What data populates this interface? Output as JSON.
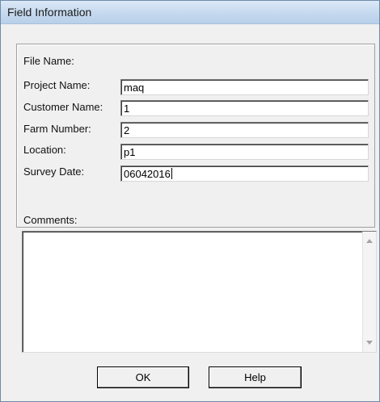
{
  "window": {
    "title": "Field Information"
  },
  "form": {
    "file_name_label": "File Name:",
    "project_name_label": "Project Name:",
    "project_name_value": "maq",
    "customer_name_label": "Customer Name:",
    "customer_name_value": "1",
    "farm_number_label": "Farm Number:",
    "farm_number_value": "2",
    "location_label": "Location:",
    "location_value": "p1",
    "survey_date_label": "Survey Date:",
    "survey_date_value": "06042016",
    "comments_label": "Comments:",
    "comments_value": ""
  },
  "buttons": {
    "ok_label": "OK",
    "help_label": "Help"
  }
}
